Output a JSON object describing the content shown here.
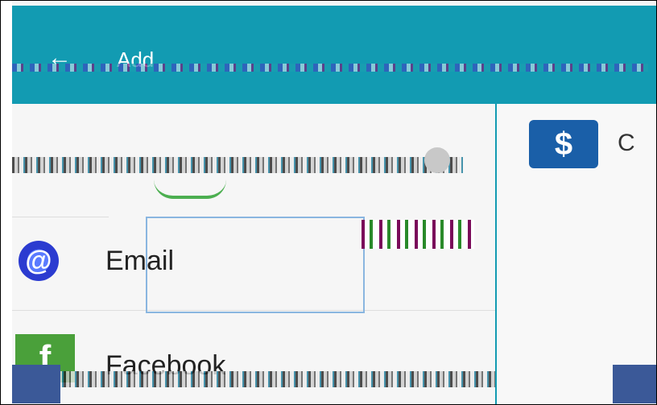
{
  "appbar": {
    "back_icon": "back-arrow-icon",
    "title": "Add"
  },
  "accent_color": "#129bb2",
  "list": {
    "items": [
      {
        "label": "Email",
        "icon": "email-icon",
        "selected": false
      },
      {
        "label": "Facebook",
        "icon": "facebook-icon",
        "selected": false
      }
    ]
  },
  "right_panel": {
    "icon": "account-icon",
    "label": "C"
  }
}
